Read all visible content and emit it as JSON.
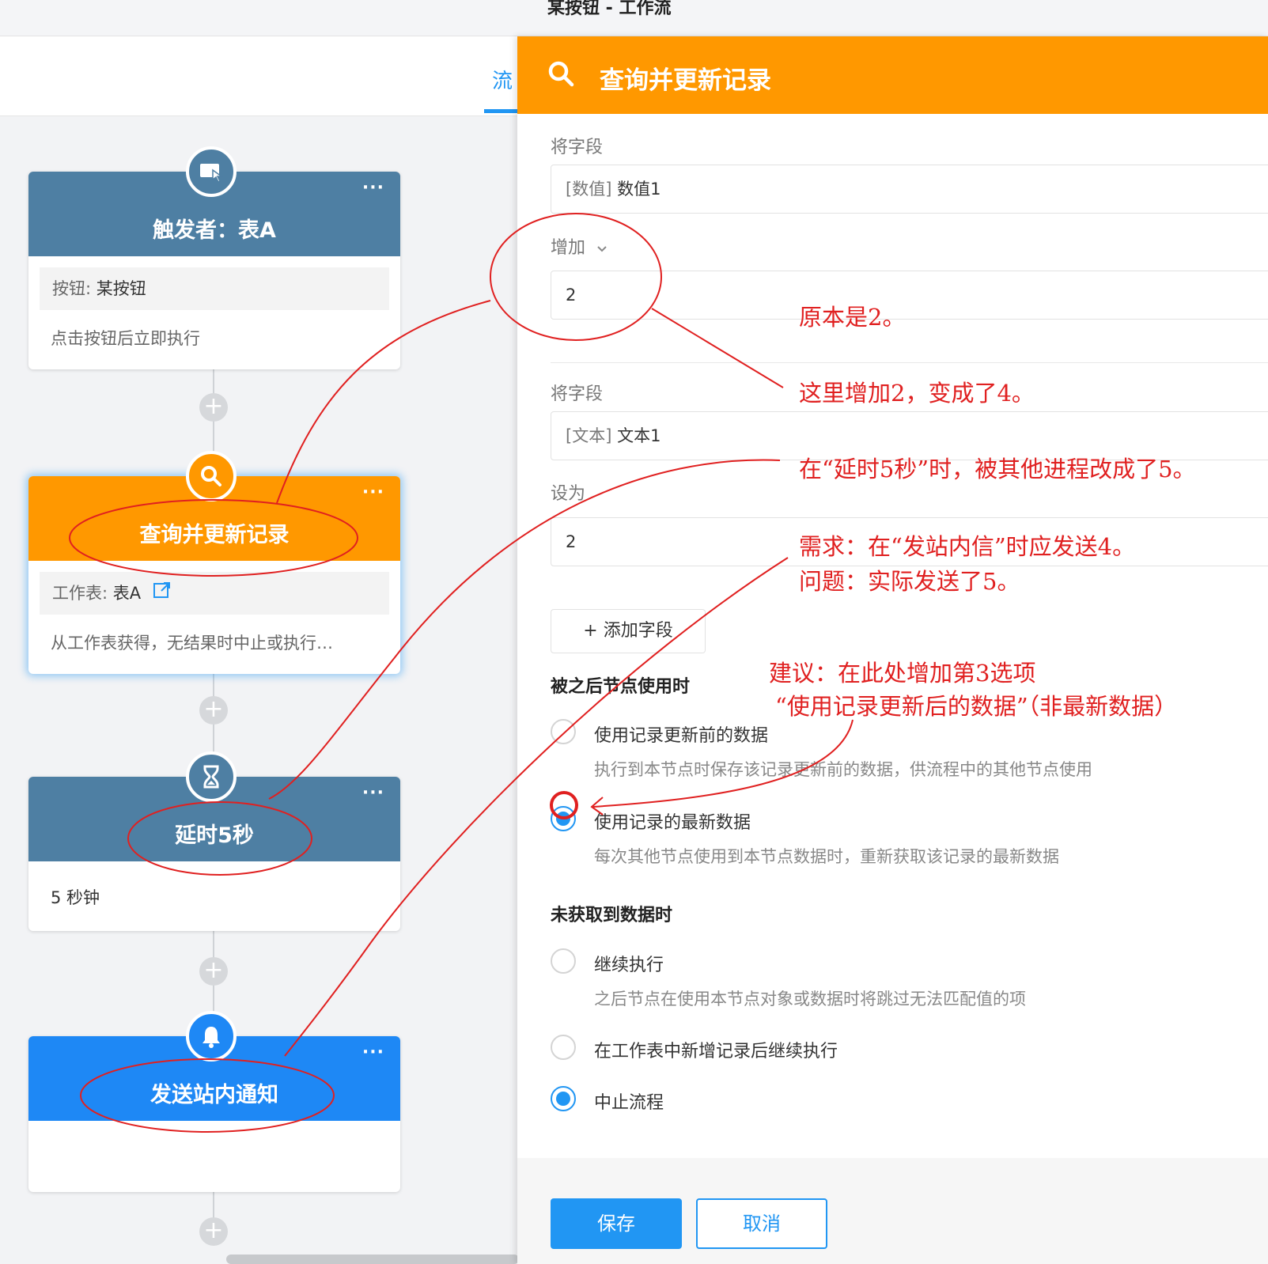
{
  "window": {
    "title": "某按钮 - 工作流"
  },
  "tabs": {
    "active": "流"
  },
  "nodes": {
    "trigger": {
      "title": "触发者：表A",
      "info_label": "按钮: ",
      "info_value": "某按钮",
      "desc": "点击按钮后立即执行",
      "color": "#4e7fa3",
      "icon": "cursor-window-icon"
    },
    "query": {
      "title": "查询并更新记录",
      "info_label": "工作表: ",
      "info_value": "表A",
      "desc": "从工作表获得，无结果时中止或执行…",
      "color": "#ff9800",
      "icon": "search-icon"
    },
    "delay": {
      "title": "延时5秒",
      "desc": "5 秒钟",
      "color": "#4e7fa3",
      "icon": "hourglass-icon"
    },
    "notify": {
      "title": "发送站内通知",
      "desc": "",
      "color": "#1e88f5",
      "icon": "bell-icon"
    },
    "more": "···",
    "add": "+"
  },
  "panel": {
    "title": "查询并更新记录",
    "field1_label": "将字段",
    "field1_tag": "[数值]",
    "field1_value": "数值1",
    "op_label": "增加",
    "op_value": "2",
    "field2_label": "将字段",
    "field2_tag": "[文本]",
    "field2_value": "文本1",
    "op2_label": "设为",
    "op2_value": "2",
    "add_field": "+ 添加字段",
    "section_used": "被之后节点使用时",
    "opt_before": "使用记录更新前的数据",
    "opt_before_desc": "执行到本节点时保存该记录更新前的数据，供流程中的其他节点使用",
    "opt_latest": "使用记录的最新数据",
    "opt_latest_desc": "每次其他节点使用到本节点数据时，重新获取该记录的最新数据",
    "section_nodata": "未获取到数据时",
    "opt_continue": "继续执行",
    "opt_continue_desc": "之后节点在使用本节点对象或数据时将跳过无法匹配值的项",
    "opt_add_continue": "在工作表中新增记录后继续执行",
    "opt_stop": "中止流程",
    "save": "保存",
    "cancel": "取消",
    "used_selected": "使用记录的最新数据",
    "nodata_selected": "中止流程"
  },
  "annotations": {
    "a1": "原本是2。",
    "a2": "这里增加2，变成了4。",
    "a3": "在“延时5秒”时，被其他进程改成了5。",
    "a4_line1": "需求：在“发站内信”时应发送4。",
    "a4_line2": "问题：实际发送了5。",
    "a5_line1": "建议：在此处增加第3选项",
    "a5_line2": "“使用记录更新后的数据”（非最新数据）",
    "color": "#e02020"
  }
}
